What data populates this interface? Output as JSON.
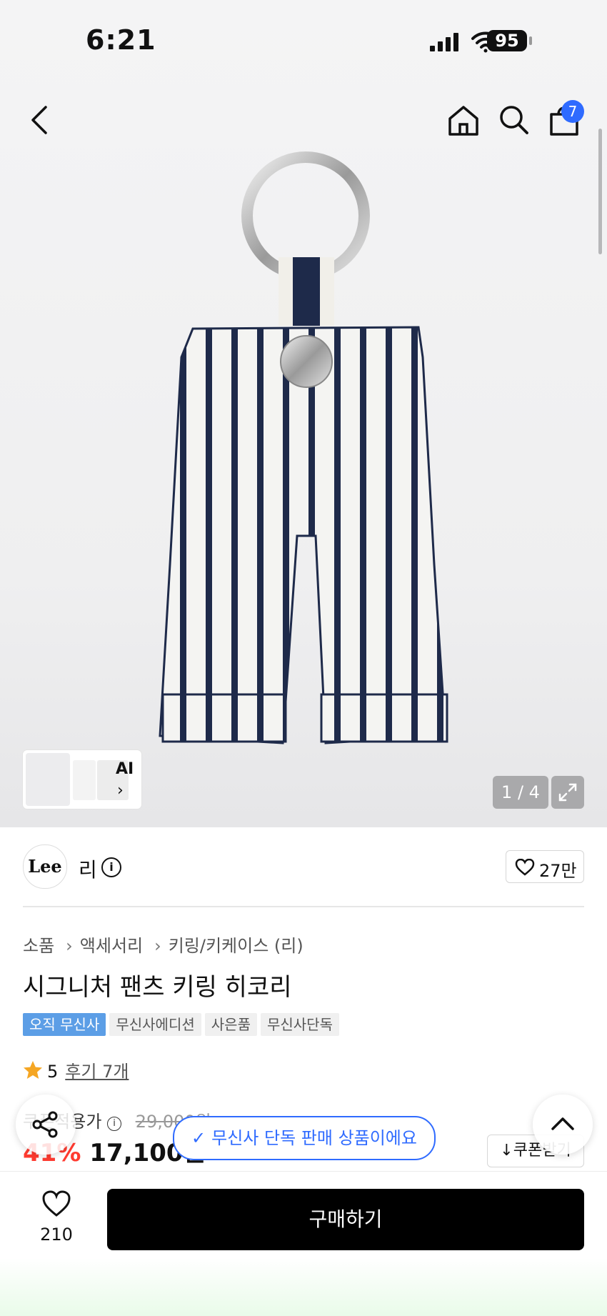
{
  "status_bar": {
    "time": "6:21",
    "battery": "95"
  },
  "header": {
    "cart_count": "7"
  },
  "gallery": {
    "ai_label": "AI",
    "page_indicator": "1 / 4"
  },
  "brand": {
    "logo_text": "Lee",
    "name": "리",
    "likes": "27만"
  },
  "breadcrumb": {
    "items": [
      "소품",
      "액세서리",
      "키링/키케이스 (리)"
    ]
  },
  "product": {
    "title": "시그니처 팬츠 키링 히코리",
    "tags": [
      "오직 무신사",
      "무신사에디션",
      "사은품",
      "무신사단독"
    ],
    "rating": "5",
    "reviews": "후기 7개",
    "price_label": "쿠폰적용가",
    "original_price": "29,000원",
    "discount": "41%",
    "sale_price": "17,100원",
    "coupon_button": "쿠폰받기"
  },
  "toast": {
    "text": "무신사 단독 판매 상품이에요"
  },
  "bottom_bar": {
    "like_count": "210",
    "buy_label": "구매하기"
  },
  "colors": {
    "accent_blue": "#2f6bff",
    "discount_red": "#ff3b30",
    "tag_blue": "#5c9ee6"
  }
}
